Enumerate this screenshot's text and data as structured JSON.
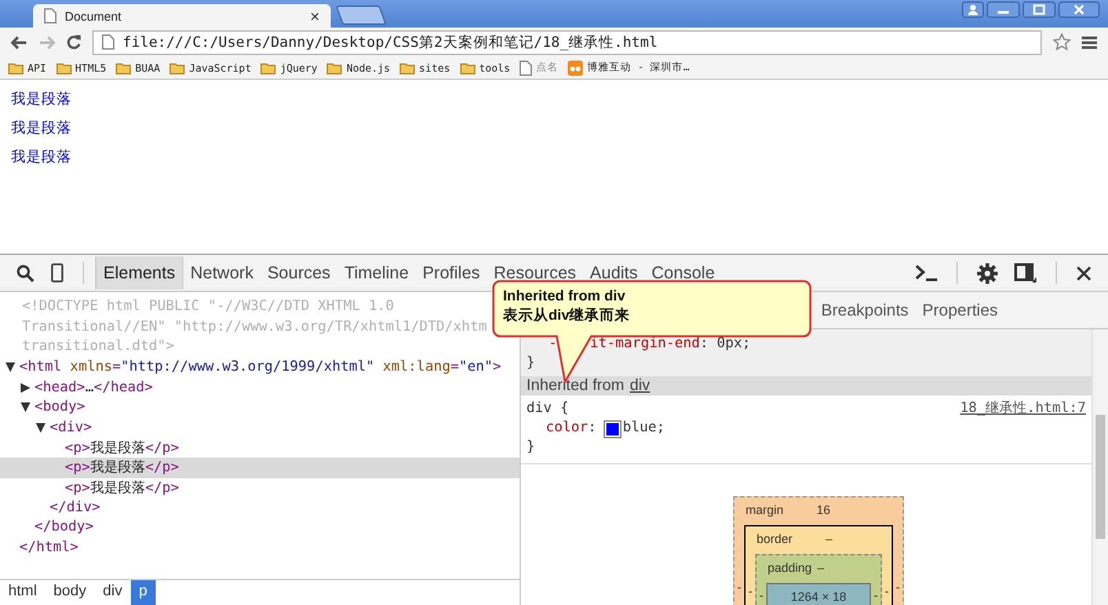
{
  "browser": {
    "tab": {
      "title": "Document",
      "close": "×"
    },
    "address": "file:///C:/Users/Danny/Desktop/CSS第2天案例和笔记/18_继承性.html",
    "bookmarks": [
      {
        "label": "API",
        "kind": "folder"
      },
      {
        "label": "HTML5",
        "kind": "folder"
      },
      {
        "label": "BUAA",
        "kind": "folder"
      },
      {
        "label": "JavaScript",
        "kind": "folder"
      },
      {
        "label": "jQuery",
        "kind": "folder"
      },
      {
        "label": "Node.js",
        "kind": "folder"
      },
      {
        "label": "sites",
        "kind": "folder"
      },
      {
        "label": "tools",
        "kind": "folder"
      },
      {
        "label": "点名",
        "kind": "page"
      },
      {
        "label": "博雅互动 - 深圳市…",
        "kind": "site"
      }
    ]
  },
  "page": {
    "paragraphs": [
      "我是段落",
      "我是段落",
      "我是段落"
    ]
  },
  "devtools": {
    "tabs": [
      {
        "label": "Elements",
        "selected": true
      },
      {
        "label": "Network",
        "selected": false
      },
      {
        "label": "Sources",
        "selected": false
      },
      {
        "label": "Timeline",
        "selected": false
      },
      {
        "label": "Profiles",
        "selected": false
      },
      {
        "label": "Resources",
        "selected": false
      },
      {
        "label": "Audits",
        "selected": false
      },
      {
        "label": "Console",
        "selected": false
      }
    ],
    "dom": {
      "doctype_lines": [
        "<!DOCTYPE html PUBLIC \"-//W3C//DTD XHTML 1.0",
        "Transitional//EN\" \"http://www.w3.org/TR/xhtml1/DTD/xhtm",
        "transitional.dtd\">"
      ],
      "nodes": [
        {
          "tokens": [
            {
              "kind": "tag",
              "text": "<html"
            },
            {
              "kind": "attr",
              "text": " xmlns"
            },
            {
              "kind": "tag",
              "text": "="
            },
            {
              "kind": "value",
              "text": "\"http://www.w3.org/1999/xhtml\""
            },
            {
              "kind": "attr",
              "text": " xml:lang"
            },
            {
              "kind": "tag",
              "text": "="
            },
            {
              "kind": "value",
              "text": "\"en\""
            },
            {
              "kind": "tag",
              "text": ">"
            }
          ],
          "expanded": true,
          "close": "</html>",
          "children": [
            {
              "tokens": [
                {
                  "kind": "tag",
                  "text": "<head>"
                },
                {
                  "kind": "text",
                  "text": "…"
                },
                {
                  "kind": "tag",
                  "text": "</head>"
                }
              ],
              "expanded": false
            },
            {
              "tokens": [
                {
                  "kind": "tag",
                  "text": "<body>"
                }
              ],
              "expanded": true,
              "close": "</body>",
              "children": [
                {
                  "tokens": [
                    {
                      "kind": "tag",
                      "text": "<div>"
                    }
                  ],
                  "expanded": true,
                  "close": "</div>",
                  "children": [
                    {
                      "tokens": [
                        {
                          "kind": "tag",
                          "text": "<p>"
                        },
                        {
                          "kind": "text",
                          "text": "我是段落"
                        },
                        {
                          "kind": "tag",
                          "text": "</p>"
                        }
                      ],
                      "selected": false
                    },
                    {
                      "tokens": [
                        {
                          "kind": "tag",
                          "text": "<p>"
                        },
                        {
                          "kind": "text",
                          "text": "我是段落"
                        },
                        {
                          "kind": "tag",
                          "text": "</p>"
                        }
                      ],
                      "selected": true
                    },
                    {
                      "tokens": [
                        {
                          "kind": "tag",
                          "text": "<p>"
                        },
                        {
                          "kind": "text",
                          "text": "我是段落"
                        },
                        {
                          "kind": "tag",
                          "text": "</p>"
                        }
                      ],
                      "selected": false
                    }
                  ]
                }
              ]
            }
          ]
        }
      ]
    },
    "breadcrumbs": [
      {
        "label": "html",
        "selected": false
      },
      {
        "label": "body",
        "selected": false
      },
      {
        "label": "div",
        "selected": false
      },
      {
        "label": "p",
        "selected": true
      }
    ],
    "sidebar_tabs": [
      {
        "label": "Breakpoints",
        "selected": false
      },
      {
        "label": "Properties",
        "selected": false
      }
    ],
    "styles": {
      "ua_rule": {
        "prefix": "-",
        "property": "it-margin-end",
        "rest": ": 0px;",
        "close": "}"
      },
      "inherited": {
        "label": "Inherited from",
        "link": "div"
      },
      "rule": {
        "selector": "div {",
        "source": "18_继承性.html:7",
        "property": "color",
        "colon": ":",
        "color": "#0000ff",
        "value": "blue;",
        "close": "}"
      }
    },
    "box_model": {
      "margin": {
        "label": "margin",
        "value": "16"
      },
      "border": {
        "label": "border",
        "value": "–"
      },
      "padding": {
        "label": "padding",
        "value": "–"
      },
      "content": "1264 × 18",
      "marks": [
        "-",
        "-",
        "-"
      ]
    }
  },
  "callout": {
    "lines": [
      "Inherited from div",
      "表示从div继承而来"
    ]
  }
}
